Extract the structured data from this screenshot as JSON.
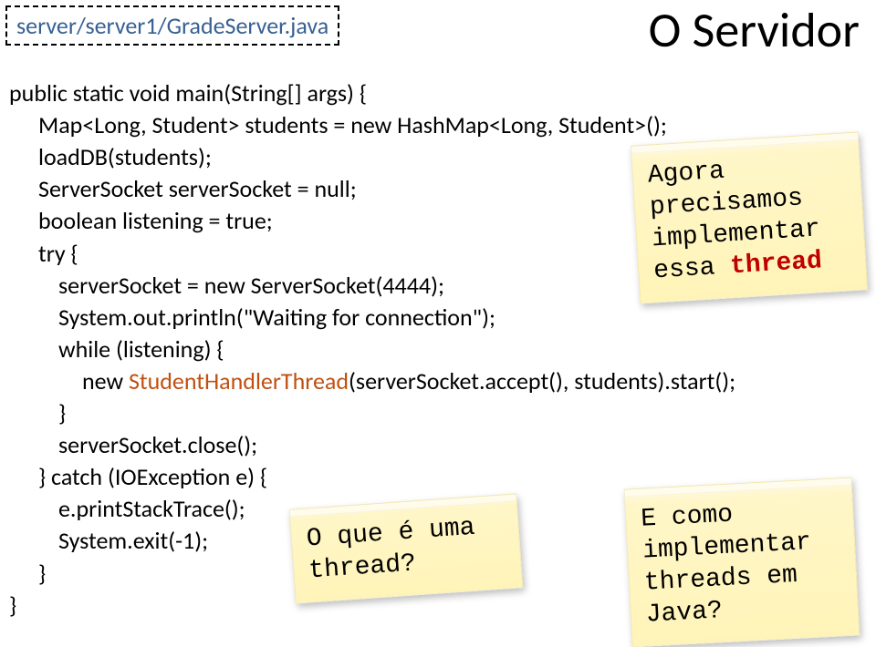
{
  "header": {
    "filepath": "server/server1/GradeServer.java",
    "title": "O Servidor"
  },
  "code": {
    "l1": "public static void main(String[] args) {",
    "l2": "Map<Long, Student> students = new HashMap<Long, Student>();",
    "l3": "loadDB(students);",
    "l4": "ServerSocket serverSocket = null;",
    "l5": "boolean listening = true;",
    "l6": "try {",
    "l7": "serverSocket = new ServerSocket(4444);",
    "l8": "System.out.println(\"Waiting for connection\");",
    "l9": "while (listening) {",
    "l10a": "new ",
    "l10b": "StudentHandlerThread",
    "l10c": "(serverSocket.accept(), students).start();",
    "l11": "}",
    "l12": "serverSocket.close();",
    "l13": "} catch (IOException e) {",
    "l14": "e.printStackTrace();",
    "l15": "System.exit(-1);",
    "l16": "}",
    "l17": "}"
  },
  "notes": {
    "n1a": "Agora",
    "n1b": "precisamos",
    "n1c": "implementar",
    "n1d_a": "essa ",
    "n1d_b": "thread",
    "n2a": "O que é uma",
    "n2b": "thread?",
    "n3a": "E como",
    "n3b": "implementar",
    "n3c": "threads em",
    "n3d": "Java?"
  }
}
